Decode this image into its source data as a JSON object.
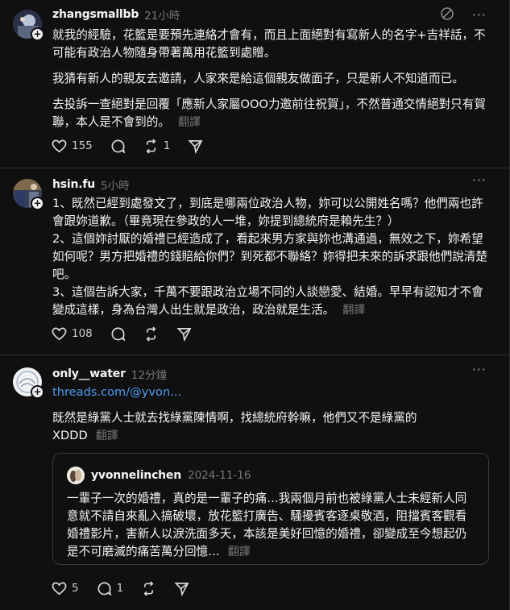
{
  "posts": [
    {
      "username": "zhangsmallbb",
      "time": "21小時",
      "paragraphs": [
        "就我的經驗，花籃是要預先連絡才會有，而且上面絕對有寫新人的名字+吉祥話，不可能有政治人物隨身帶著萬用花籃到處贈。",
        "我猜有新人的親友去邀請，人家來是給這個親友做面子，只是新人不知道而已。",
        "去投訴一查絕對是回覆「應新人家屬OOO力邀前往祝賀」，不然普通交情絕對只有賀聯，本人是不會到的。"
      ],
      "translate": "翻譯",
      "likes": "155",
      "reposts": "1"
    },
    {
      "username": "hsin.fu",
      "time": "5小時",
      "paragraphs": [
        "1、既然已經到處發文了，到底是哪兩位政治人物，妳可以公開姓名嗎？他們兩也許會跟妳道歉。（畢竟現在參政的人一堆，妳提到總統府是賴先生？）",
        "2、這個妳討厭的婚禮已經造成了，看起來男方家與妳也溝通過，無效之下，妳希望如何呢？男方把婚禮的錢賠給你們？到死都不聯絡？妳得把未來的訴求跟他們說清楚吧。",
        "3、這個告訴大家，千萬不要跟政治立場不同的人談戀愛、結婚。早早有認知才不會變成這樣，身為台灣人出生就是政治，政治就是生活。"
      ],
      "translate": "翻譯",
      "likes": "108"
    },
    {
      "username": "only__water",
      "time": "12分鐘",
      "link": "threads.com/@yvon...",
      "text": "既然是綠黨人士就去找綠黨陳情啊，找總統府幹嘛，他們又不是綠黨的XDDD",
      "translate": "翻譯",
      "likes": "5",
      "comments": "1",
      "quote": {
        "username": "yvonnelinchen",
        "date": "2024-11-16",
        "text": "一輩子一次的婚禮，真的是一輩子的痛…我兩個月前也被綠黨人士未經新人同意就不請自來亂入搞破壞，放花籃打廣告、騷擾賓客逐桌敬酒，阻擋賓客觀看婚禮影片，害新人以淚洗面多天，本該是美好回憶的婚禮，卻變成至今想起仍是不可磨滅的痛苦萬分回憶…",
        "translate": "翻譯"
      }
    }
  ],
  "icons": {
    "heart": "heart-icon",
    "comment": "comment-icon",
    "repost": "repost-icon",
    "share": "share-icon",
    "more": "more-icon",
    "mute": "mute-icon"
  }
}
